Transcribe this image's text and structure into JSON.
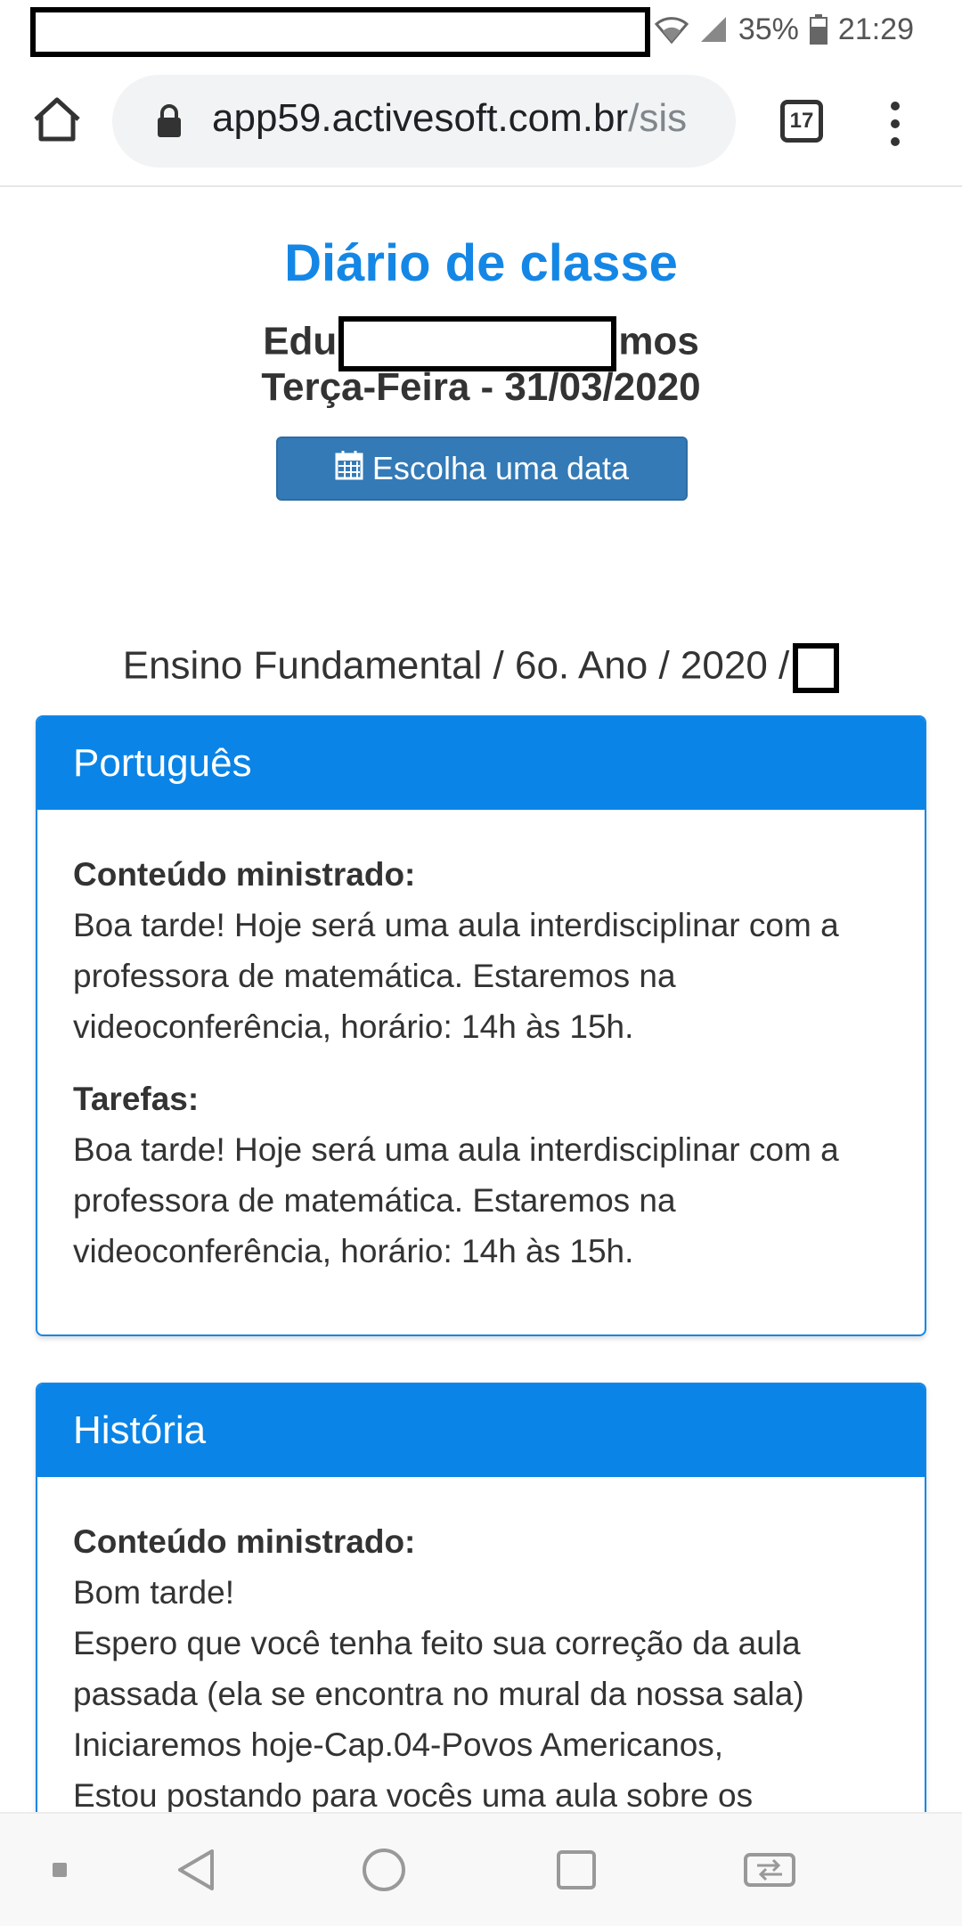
{
  "status_bar": {
    "battery": "35%",
    "time": "21:29",
    "icons": [
      "wifi-icon",
      "signal-icon",
      "battery-icon"
    ]
  },
  "browser": {
    "url_host": "app59.activesoft.com.br",
    "url_path": "/sis",
    "tab_count": "17",
    "icons": [
      "home-icon",
      "lock-icon",
      "tabs-icon",
      "more-vert-icon"
    ]
  },
  "header": {
    "title": "Diário de classe",
    "student_prefix": "Edu",
    "student_suffix": "mos",
    "date": "Terça-Feira - 31/03/2020",
    "choose_date_button": "Escolha uma data",
    "class_info": "Ensino Fundamental / 6o. Ano / 2020 /"
  },
  "panels": [
    {
      "subject": "Português",
      "content_label": "Conteúdo ministrado:",
      "content_text": "Boa tarde! Hoje será uma aula interdisciplinar com a professora de matemática. Estaremos na videoconferência, horário: 14h às 15h.",
      "tasks_label": "Tarefas:",
      "tasks_text": "Boa tarde! Hoje será uma aula interdisciplinar com a professora de matemática. Estaremos na videoconferência, horário: 14h às 15h."
    },
    {
      "subject": "História",
      "content_label": "Conteúdo ministrado:",
      "content_lines": [
        "Bom tarde!",
        "Espero que você tenha feito sua correção da aula passada (ela se encontra no mural da nossa sala)",
        "Iniciaremos hoje-Cap.04-Povos Americanos,",
        "Estou postando  para vocês uma aula sobre os"
      ]
    }
  ],
  "colors": {
    "title_blue": "#1487e6",
    "panel_header_blue": "#0a84e6",
    "button_blue": "#337ab7"
  },
  "nav_bar": {
    "icons": [
      "recent-dot-icon",
      "back-icon",
      "home-circle-icon",
      "overview-icon",
      "switch-app-icon"
    ]
  }
}
